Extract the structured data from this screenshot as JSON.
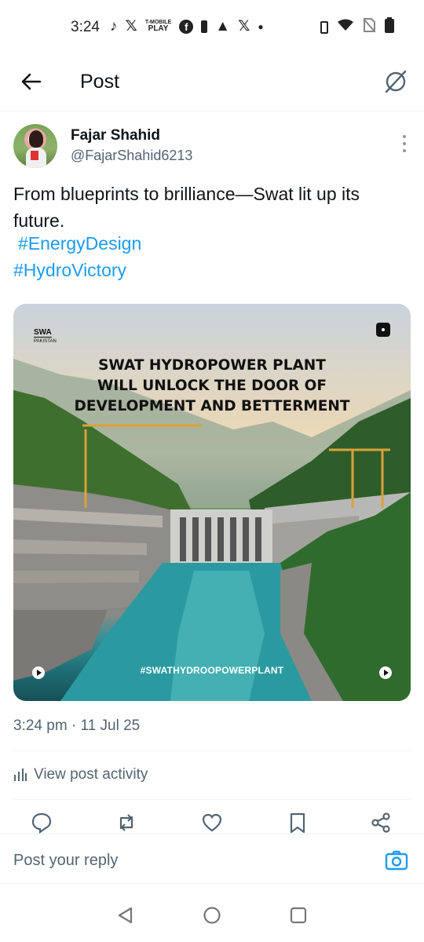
{
  "status_bar": {
    "time": "3:24",
    "mini_play_label_top": "T-MOBILE",
    "mini_play_label_bottom": "PLAY",
    "notification_icons": [
      "tiktok-icon",
      "x-icon",
      "tmobile-play-icon",
      "facebook-icon",
      "battery-saver-icon",
      "warning-icon",
      "x-icon",
      "dot-icon"
    ],
    "system_icons": [
      "vibrate-icon",
      "wifi-icon",
      "no-sim-icon",
      "battery-icon"
    ]
  },
  "header": {
    "title": "Post"
  },
  "tweet": {
    "author_name": "Fajar Shahid",
    "author_handle": "@FajarShahid6213",
    "text_line": "From blueprints to brilliance—Swat lit up its future.",
    "hashtags": [
      "#EnergyDesign",
      "#HydroVictory"
    ],
    "media": {
      "logo_main": "SWA",
      "logo_sub": "PAKISTAN",
      "headline_lines": [
        "SWAT HYDROPOWER PLANT",
        "WILL UNLOCK THE DOOR OF",
        "DEVELOPMENT AND BETTERMENT"
      ],
      "footer_tag": "#SWATHYDROOPOWERPLANT"
    },
    "timestamp": "3:24 pm · 11 Jul 25",
    "activity_label": "View post activity"
  },
  "actions": [
    "reply-icon",
    "repost-icon",
    "like-icon",
    "bookmark-icon",
    "share-icon"
  ],
  "reply_bar": {
    "placeholder": "Post your reply"
  },
  "colors": {
    "link": "#1d9bf0",
    "secondary_text": "#536471",
    "primary_text": "#0f1419",
    "divider": "#eff3f4"
  }
}
